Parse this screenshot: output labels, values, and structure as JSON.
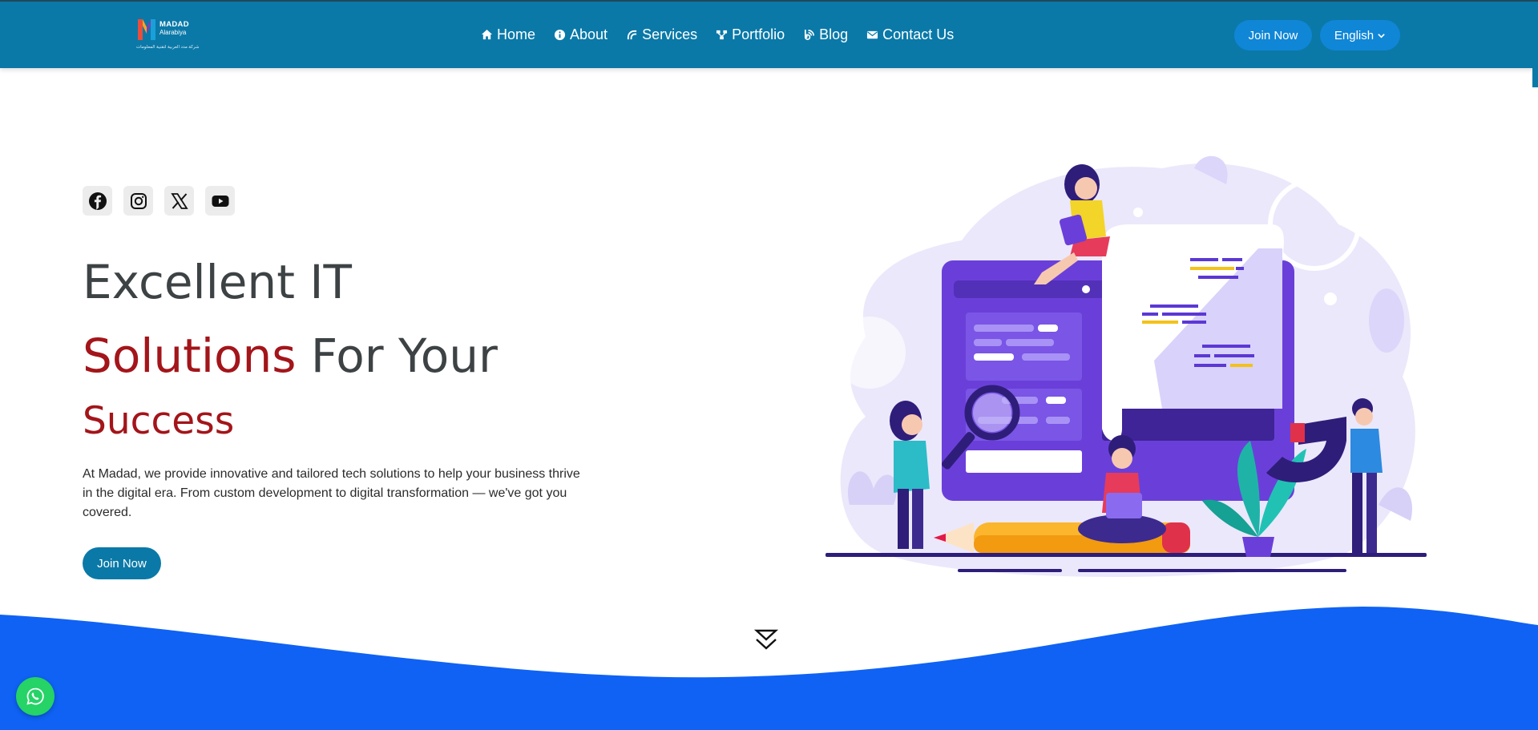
{
  "header": {
    "logo": {
      "name_line1": "MADAD",
      "name_line2": "Alarabiya",
      "arabic_tagline": "شركة مدد العربية لتقنية المعلومات"
    },
    "nav": [
      {
        "label": "Home",
        "icon": "home-icon"
      },
      {
        "label": "About",
        "icon": "info-icon"
      },
      {
        "label": "Services",
        "icon": "services-icon"
      },
      {
        "label": "Portfolio",
        "icon": "portfolio-icon"
      },
      {
        "label": "Blog",
        "icon": "blog-icon"
      },
      {
        "label": "Contact Us",
        "icon": "envelope-icon"
      }
    ],
    "join_label": "Join Now",
    "language": "English"
  },
  "socials": [
    {
      "icon": "facebook-icon"
    },
    {
      "icon": "instagram-icon"
    },
    {
      "icon": "x-icon"
    },
    {
      "icon": "youtube-icon"
    }
  ],
  "hero": {
    "line1": "Excellent IT",
    "line2_highlight": "Solutions",
    "line2_rest": " For Your",
    "line3": "Success",
    "description": "At Madad, we provide innovative and tailored tech solutions to help your business thrive in the digital era. From custom development to digital transformation — we've got you covered.",
    "cta_label": "Join Now"
  },
  "colors": {
    "header_bg": "#0a79a8",
    "button_bg": "#1086d6",
    "accent_red": "#a3151a",
    "heading_dark": "#3d4244",
    "wave_blue": "#0f62f4",
    "whatsapp_green": "#25d366"
  }
}
